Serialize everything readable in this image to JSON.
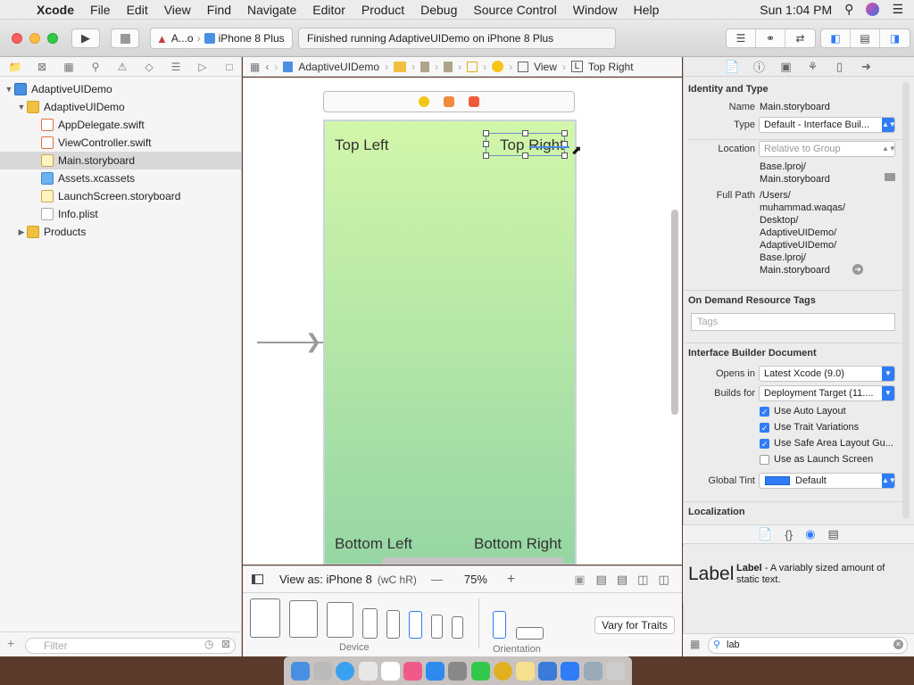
{
  "menubar": {
    "app_name": "Xcode",
    "items": [
      "File",
      "Edit",
      "View",
      "Find",
      "Navigate",
      "Editor",
      "Product",
      "Debug",
      "Source Control",
      "Window",
      "Help"
    ],
    "clock": "Sun 1:04 PM"
  },
  "toolbar": {
    "scheme_short": "A...o",
    "device": "iPhone 8 Plus",
    "activity_status": "Finished running AdaptiveUIDemo on iPhone 8 Plus"
  },
  "navigator": {
    "items": [
      {
        "label": "AdaptiveUIDemo",
        "type": "project",
        "indent": 0,
        "disclosure": "open"
      },
      {
        "label": "AdaptiveUIDemo",
        "type": "folder",
        "indent": 1,
        "disclosure": "open"
      },
      {
        "label": "AppDelegate.swift",
        "type": "swift",
        "indent": 2
      },
      {
        "label": "ViewController.swift",
        "type": "swift",
        "indent": 2
      },
      {
        "label": "Main.storyboard",
        "type": "storyboard",
        "indent": 2,
        "selected": true
      },
      {
        "label": "Assets.xcassets",
        "type": "assets",
        "indent": 2
      },
      {
        "label": "LaunchScreen.storyboard",
        "type": "storyboard",
        "indent": 2
      },
      {
        "label": "Info.plist",
        "type": "plist",
        "indent": 2
      },
      {
        "label": "Products",
        "type": "folder",
        "indent": 1,
        "disclosure": "closed"
      }
    ],
    "filter_placeholder": "Filter"
  },
  "jumpbar": {
    "project": "AdaptiveUIDemo",
    "view": "View",
    "label_marker": "L",
    "selected": "Top Right"
  },
  "canvas": {
    "labels": {
      "top_left": "Top Left",
      "top_right": "Top Right",
      "bottom_left": "Bottom Left",
      "bottom_right": "Bottom Right"
    }
  },
  "bottombar": {
    "view_as": "View as: iPhone 8",
    "size_class_w": "wC",
    "size_class_h": "hR",
    "zoom": "75%",
    "minus": "—",
    "plus": "+",
    "device_caption": "Device",
    "orientation_caption": "Orientation",
    "vary_button": "Vary for Traits"
  },
  "inspector": {
    "identity_title": "Identity and Type",
    "name_label": "Name",
    "name_value": "Main.storyboard",
    "type_label": "Type",
    "type_value": "Default - Interface Buil...",
    "location_label": "Location",
    "location_value": "Relative to Group",
    "location_path_1": "Base.lproj/",
    "location_path_2": "Main.storyboard",
    "full_path_label": "Full Path",
    "full_path": [
      "/Users/",
      "muhammad.waqas/",
      "Desktop/",
      "AdaptiveUIDemo/",
      "AdaptiveUIDemo/",
      "Base.lproj/",
      "Main.storyboard"
    ],
    "odr_title": "On Demand Resource Tags",
    "tags_placeholder": "Tags",
    "ibdoc_title": "Interface Builder Document",
    "opens_in_label": "Opens in",
    "opens_in_value": "Latest Xcode (9.0)",
    "builds_for_label": "Builds for",
    "builds_for_value": "Deployment Target (11....",
    "checkboxes": [
      {
        "label": "Use Auto Layout",
        "checked": true
      },
      {
        "label": "Use Trait Variations",
        "checked": true
      },
      {
        "label": "Use Safe Area Layout Gu...",
        "checked": true
      },
      {
        "label": "Use as Launch Screen",
        "checked": false
      }
    ],
    "global_tint_label": "Global Tint",
    "global_tint_value": "Default",
    "global_tint_color": "#2f7cf6",
    "localization_title": "Localization"
  },
  "library": {
    "item_title": "Label",
    "item_name": "Label",
    "item_desc": " - A variably sized amount of static text.",
    "search_value": "lab"
  },
  "colors": {
    "accent": "#2f7cf6",
    "scene_top": "#d2f6aa",
    "scene_bottom": "#96d6a4"
  }
}
